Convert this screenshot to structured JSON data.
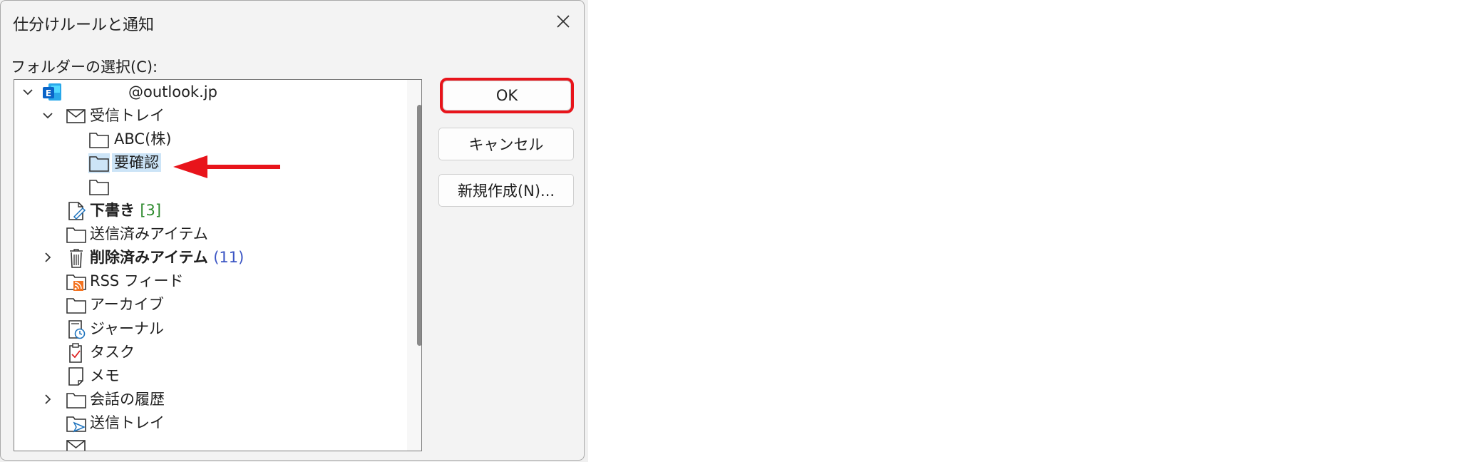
{
  "dialog": {
    "title": "仕分けルールと通知",
    "folder_label": "フォルダーの選択(C):",
    "account": "@outlook.jp",
    "tree": [
      {
        "key": "inbox",
        "label": "受信トレイ",
        "icon": "mail-icon",
        "expanded": true
      },
      {
        "key": "abc",
        "label": "ABC(株)",
        "icon": "folder-icon"
      },
      {
        "key": "review",
        "label": "要確認",
        "icon": "folder-icon",
        "selected": true
      },
      {
        "key": "blank",
        "label": "",
        "icon": "folder-icon"
      },
      {
        "key": "drafts",
        "label": "下書き",
        "count": "[3]",
        "icon": "drafts-icon",
        "bold": true
      },
      {
        "key": "sent",
        "label": "送信済みアイテム",
        "icon": "folder-icon"
      },
      {
        "key": "deleted",
        "label": "削除済みアイテム",
        "count": "(11)",
        "icon": "trash-icon",
        "bold": true,
        "collapsed": true
      },
      {
        "key": "rss",
        "label": "RSS フィード",
        "icon": "rss-folder-icon"
      },
      {
        "key": "archive",
        "label": "アーカイブ",
        "icon": "folder-icon"
      },
      {
        "key": "journal",
        "label": "ジャーナル",
        "icon": "journal-icon"
      },
      {
        "key": "tasks",
        "label": "タスク",
        "icon": "tasks-icon"
      },
      {
        "key": "notes",
        "label": "メモ",
        "icon": "note-icon"
      },
      {
        "key": "history",
        "label": "会話の履歴",
        "icon": "folder-icon",
        "collapsed": true
      },
      {
        "key": "outbox",
        "label": "送信トレイ",
        "icon": "outbox-icon"
      }
    ],
    "buttons": {
      "ok": "OK",
      "cancel": "キャンセル",
      "new": "新規作成(N)..."
    }
  },
  "colors": {
    "highlight": "#e8141b",
    "selection": "#cce4f7",
    "outlook_blue": "#0a64c8"
  }
}
